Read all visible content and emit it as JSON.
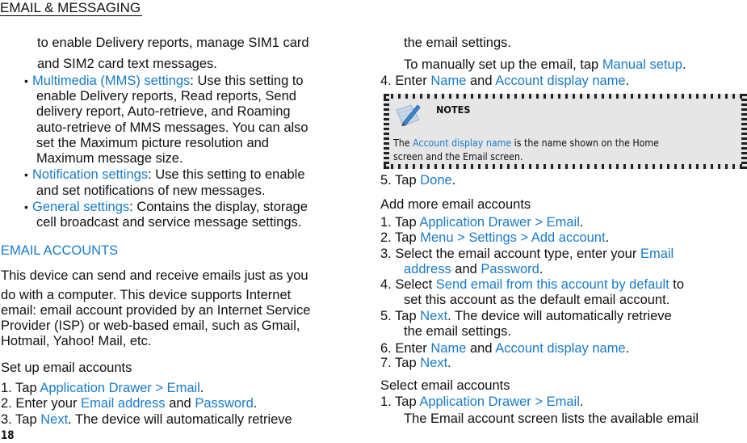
{
  "header": {
    "title": "EMAIL & MESSAGING"
  },
  "page_number": "18",
  "left": {
    "intro_lines": [
      "to enable Delivery reports, manage SIM1 card",
      "and SIM2 card text messages."
    ],
    "bullets": [
      {
        "link": "Multimedia (MMS) settings",
        "text": ": Use this setting to",
        "cont": [
          "enable Delivery reports, Read reports, Send",
          "delivery report, Auto-retrieve, and Roaming",
          "auto-retrieve of MMS messages. You can also",
          "set the Maximum picture resolution and",
          "Maximum message size."
        ]
      },
      {
        "link": "Notification settings",
        "text": ": Use this setting to enable",
        "cont": [
          "and set notifications of new messages."
        ]
      },
      {
        "link": "General settings",
        "text": ": Contains the display, storage",
        "cont": [
          "cell broadcast and service message settings."
        ]
      }
    ],
    "section_title": "EMAIL ACCOUNTS",
    "paragraph": [
      "This device can send and receive emails just as you",
      "do with a computer. This device supports Internet",
      "email: email account provided by an Internet Service",
      "Provider (ISP) or web-based email, such as Gmail,",
      "Hotmail, Yahoo! Mail, etc."
    ],
    "setup_heading": "Set up email accounts",
    "setup_steps": [
      {
        "pre": "1. Tap ",
        "link": "Application Drawer > Email",
        "post": "."
      },
      {
        "pre": "2. Enter your ",
        "link": "Email address",
        "mid": " and ",
        "link2": "Password",
        "post": "."
      },
      {
        "pre": "3. Tap ",
        "link": "Next",
        "post": ". The device will automatically retrieve"
      }
    ]
  },
  "right": {
    "cont_line": "the email settings.",
    "manual_pre": "To manually set up the email, tap ",
    "manual_link": "Manual setup",
    "manual_post": ".",
    "step4": {
      "pre": "4. Enter ",
      "link": "Name",
      "mid": " and ",
      "link2": "Account display name",
      "post": "."
    },
    "notes": {
      "title": "NOTES",
      "line1_pre": "The ",
      "line1_link": "Account display name",
      "line1_post": " is the name shown on the Home",
      "line2": "screen and the Email screen."
    },
    "step5": {
      "pre": "5. Tap ",
      "link": "Done",
      "post": "."
    },
    "add_heading": "Add more email accounts",
    "add_steps": {
      "s1": {
        "pre": "1. Tap ",
        "link": "Application Drawer > Email",
        "post": "."
      },
      "s2": {
        "pre": "2. Tap ",
        "link": "Menu > Settings > Add account",
        "post": "."
      },
      "s3": {
        "pre": "3. Select the email account type, enter your ",
        "link": "Email",
        "cont_link": "address",
        "cont_mid": " and ",
        "cont_link2": "Password",
        "cont_post": "."
      },
      "s4": {
        "pre": "4. Select ",
        "link": "Send email from this account by default",
        "post": " to",
        "cont": "set this account as the default email account."
      },
      "s5": {
        "pre": "5. Tap ",
        "link": "Next",
        "post": ". The device will automatically retrieve",
        "cont": "the email settings."
      },
      "s6": {
        "pre": "6. Enter ",
        "link": "Name",
        "mid": " and ",
        "link2": "Account display name",
        "post": "."
      },
      "s7": {
        "pre": "7. Tap ",
        "link": "Next",
        "post": "."
      }
    },
    "select_heading": "Select email accounts",
    "select_steps": {
      "s1": {
        "pre": "1. Tap ",
        "link": "Application Drawer > Email",
        "post": "."
      },
      "cont": "The Email account screen lists the available email"
    },
    "link_color": "#1a7bc9"
  }
}
